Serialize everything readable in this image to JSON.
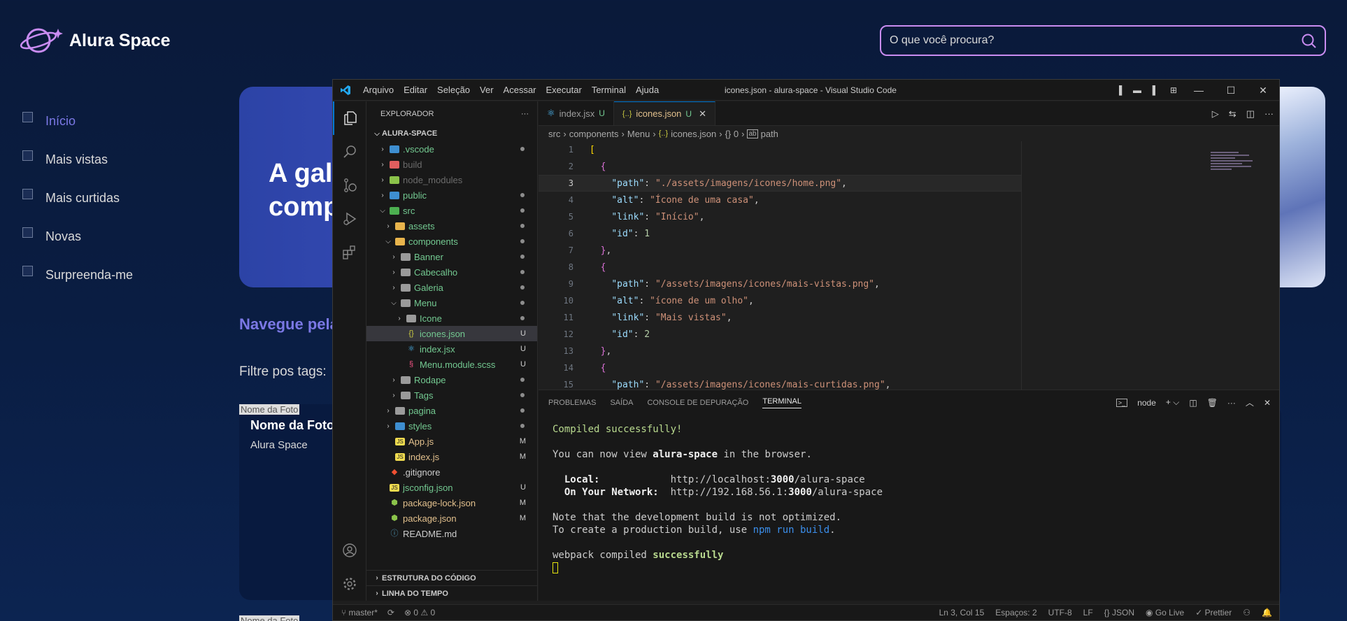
{
  "site": {
    "logo_text": "Alura Space",
    "search_placeholder": "O que você procura?",
    "nav": [
      {
        "label": "Início",
        "active": true
      },
      {
        "label": "Mais vistas"
      },
      {
        "label": "Mais curtidas"
      },
      {
        "label": "Novas"
      },
      {
        "label": "Surpreenda-me"
      }
    ],
    "banner_title_line1": "A gal",
    "banner_title_line2": "comp",
    "gallery_heading": "Navegue pela",
    "tags_label": "Filtre pos tags:",
    "photo_alt": "Nome da Foto",
    "photo_title": "Nome da Foto",
    "photo_credit": "Alura Space",
    "photo_alt_2": "Nome da Foto",
    "accent_color": "#7b78e5",
    "search_border_color": "#c98cf1"
  },
  "vscode": {
    "menu": [
      "Arquivo",
      "Editar",
      "Seleção",
      "Ver",
      "Acessar",
      "Executar",
      "Terminal",
      "Ajuda"
    ],
    "window_title": "icones.json - alura-space - Visual Studio Code",
    "explorer": {
      "title": "EXPLORADOR",
      "more": "···",
      "root": "ALURA-SPACE",
      "items": [
        {
          "name": ".vscode",
          "depth": 1,
          "type": "folder",
          "color": "#3e8ed0",
          "status": "dot"
        },
        {
          "name": "build",
          "depth": 1,
          "type": "folder",
          "color": "#e05e5e",
          "dim": true
        },
        {
          "name": "node_modules",
          "depth": 1,
          "type": "folder",
          "color": "#8bc34a",
          "dim": true
        },
        {
          "name": "public",
          "depth": 1,
          "type": "folder",
          "color": "#3e8ed0",
          "status": "dot"
        },
        {
          "name": "src",
          "depth": 1,
          "type": "folder-open",
          "color": "#4caf50",
          "status": "dot"
        },
        {
          "name": "assets",
          "depth": 2,
          "type": "folder",
          "color": "#e8b44c",
          "status": "dot"
        },
        {
          "name": "components",
          "depth": 2,
          "type": "folder-open",
          "color": "#e8b44c",
          "status": "dot"
        },
        {
          "name": "Banner",
          "depth": 3,
          "type": "folder",
          "color": "#9a9a9a",
          "status": "dot"
        },
        {
          "name": "Cabecalho",
          "depth": 3,
          "type": "folder",
          "color": "#9a9a9a",
          "status": "dot"
        },
        {
          "name": "Galeria",
          "depth": 3,
          "type": "folder",
          "color": "#9a9a9a",
          "status": "dot"
        },
        {
          "name": "Menu",
          "depth": 3,
          "type": "folder-open",
          "color": "#9a9a9a",
          "status": "dot"
        },
        {
          "name": "Icone",
          "depth": 4,
          "type": "folder",
          "color": "#9a9a9a",
          "status": "dot"
        },
        {
          "name": "icones.json",
          "depth": 4,
          "type": "json",
          "color": "#cbcb41",
          "status": "U",
          "selected": true
        },
        {
          "name": "index.jsx",
          "depth": 4,
          "type": "react",
          "color": "#4fc1ff",
          "status": "U"
        },
        {
          "name": "Menu.module.scss",
          "depth": 4,
          "type": "scss",
          "color": "#f55385",
          "status": "U"
        },
        {
          "name": "Rodape",
          "depth": 3,
          "type": "folder",
          "color": "#9a9a9a",
          "status": "dot"
        },
        {
          "name": "Tags",
          "depth": 3,
          "type": "folder",
          "color": "#9a9a9a",
          "status": "dot"
        },
        {
          "name": "pagina",
          "depth": 2,
          "type": "folder",
          "color": "#9a9a9a",
          "status": "dot"
        },
        {
          "name": "styles",
          "depth": 2,
          "type": "folder",
          "color": "#3e8ed0",
          "status": "dot"
        },
        {
          "name": "App.js",
          "depth": 2,
          "type": "js",
          "color": "#f0db4f",
          "status": "M"
        },
        {
          "name": "index.js",
          "depth": 2,
          "type": "js",
          "color": "#f0db4f",
          "status": "M"
        },
        {
          "name": ".gitignore",
          "depth": 1,
          "type": "git",
          "color": "#f05032"
        },
        {
          "name": "jsconfig.json",
          "depth": 1,
          "type": "js",
          "color": "#f0db4f",
          "status": "U"
        },
        {
          "name": "package-lock.json",
          "depth": 1,
          "type": "npm",
          "color": "#8bc34a",
          "status": "M"
        },
        {
          "name": "package.json",
          "depth": 1,
          "type": "npm",
          "color": "#8bc34a",
          "status": "M"
        },
        {
          "name": "README.md",
          "depth": 1,
          "type": "info",
          "color": "#519aba"
        }
      ],
      "outline": "ESTRUTURA DO CÓDIGO",
      "timeline": "LINHA DO TEMPO"
    },
    "tabs": [
      {
        "label": "index.jsx",
        "badge": "U",
        "active": false
      },
      {
        "label": "icones.json",
        "badge": "U",
        "active": true
      }
    ],
    "breadcrumb": [
      "src",
      "components",
      "Menu",
      "icones.json",
      "{} 0",
      "path"
    ],
    "code": {
      "current_line": 3,
      "line_numbers": [
        "1",
        "2",
        "3",
        "4",
        "5",
        "6",
        "7",
        "8",
        "9",
        "10",
        "11",
        "12",
        "13",
        "14",
        "15"
      ],
      "lines": [
        [
          [
            "b1",
            "["
          ]
        ],
        [
          [
            "p",
            "  "
          ],
          [
            "b2",
            "{"
          ]
        ],
        [
          [
            "p",
            "    "
          ],
          [
            "k",
            "\"path\""
          ],
          [
            "p",
            ": "
          ],
          [
            "s",
            "\"./assets/imagens/icones/home.png\""
          ],
          [
            "p",
            ","
          ]
        ],
        [
          [
            "p",
            "    "
          ],
          [
            "k",
            "\"alt\""
          ],
          [
            "p",
            ": "
          ],
          [
            "s",
            "\"Ícone de uma casa\""
          ],
          [
            "p",
            ","
          ]
        ],
        [
          [
            "p",
            "    "
          ],
          [
            "k",
            "\"link\""
          ],
          [
            "p",
            ": "
          ],
          [
            "s",
            "\"Início\""
          ],
          [
            "p",
            ","
          ]
        ],
        [
          [
            "p",
            "    "
          ],
          [
            "k",
            "\"id\""
          ],
          [
            "p",
            ": "
          ],
          [
            "n",
            "1"
          ]
        ],
        [
          [
            "p",
            "  "
          ],
          [
            "b2",
            "}"
          ],
          [
            "p",
            ","
          ]
        ],
        [
          [
            "p",
            "  "
          ],
          [
            "b2",
            "{"
          ]
        ],
        [
          [
            "p",
            "    "
          ],
          [
            "k",
            "\"path\""
          ],
          [
            "p",
            ": "
          ],
          [
            "s",
            "\"/assets/imagens/icones/mais-vistas.png\""
          ],
          [
            "p",
            ","
          ]
        ],
        [
          [
            "p",
            "    "
          ],
          [
            "k",
            "\"alt\""
          ],
          [
            "p",
            ": "
          ],
          [
            "s",
            "\"ícone de um olho\""
          ],
          [
            "p",
            ","
          ]
        ],
        [
          [
            "p",
            "    "
          ],
          [
            "k",
            "\"link\""
          ],
          [
            "p",
            ": "
          ],
          [
            "s",
            "\"Mais vistas\""
          ],
          [
            "p",
            ","
          ]
        ],
        [
          [
            "p",
            "    "
          ],
          [
            "k",
            "\"id\""
          ],
          [
            "p",
            ": "
          ],
          [
            "n",
            "2"
          ]
        ],
        [
          [
            "p",
            "  "
          ],
          [
            "b2",
            "}"
          ],
          [
            "p",
            ","
          ]
        ],
        [
          [
            "p",
            "  "
          ],
          [
            "b2",
            "{"
          ]
        ],
        [
          [
            "p",
            "    "
          ],
          [
            "k",
            "\"path\""
          ],
          [
            "p",
            ": "
          ],
          [
            "s",
            "\"/assets/imagens/icones/mais-curtidas.png\""
          ],
          [
            "p",
            ","
          ]
        ]
      ]
    },
    "panel": {
      "tabs": [
        "PROBLEMAS",
        "SAÍDA",
        "CONSOLE DE DEPURAÇÃO",
        "TERMINAL"
      ],
      "active_tab": "TERMINAL",
      "terminal_name": "node",
      "terminal": [
        [
          [
            "tg",
            "Compiled successfully!"
          ]
        ],
        [],
        [
          [
            "tw",
            "You can now view "
          ],
          [
            "tb",
            "alura-space"
          ],
          [
            "tw",
            " in the browser."
          ]
        ],
        [],
        [
          [
            "tw",
            "  "
          ],
          [
            "tb",
            "Local:"
          ],
          [
            "tw",
            "            http://localhost:"
          ],
          [
            "tb",
            "3000"
          ],
          [
            "tw",
            "/alura-space"
          ]
        ],
        [
          [
            "tw",
            "  "
          ],
          [
            "tb",
            "On Your Network:"
          ],
          [
            "tw",
            "  http://192.168.56.1:"
          ],
          [
            "tb",
            "3000"
          ],
          [
            "tw",
            "/alura-space"
          ]
        ],
        [],
        [
          [
            "tw",
            "Note that the development build is not optimized."
          ]
        ],
        [
          [
            "tw",
            "To create a production build, use "
          ],
          [
            "tc",
            "npm run build"
          ],
          [
            "tw",
            "."
          ]
        ],
        [],
        [
          [
            "tw",
            "webpack compiled "
          ],
          [
            "tbg",
            "successfully"
          ]
        ]
      ]
    },
    "statusbar": {
      "branch": "master*",
      "problems": "⊗ 0 ⚠ 0",
      "position": "Ln 3, Col 15",
      "spaces": "Espaços: 2",
      "encoding": "UTF-8",
      "eol": "LF",
      "language": "{} JSON",
      "golive": "Go Live",
      "prettier": "✓ Prettier"
    }
  }
}
